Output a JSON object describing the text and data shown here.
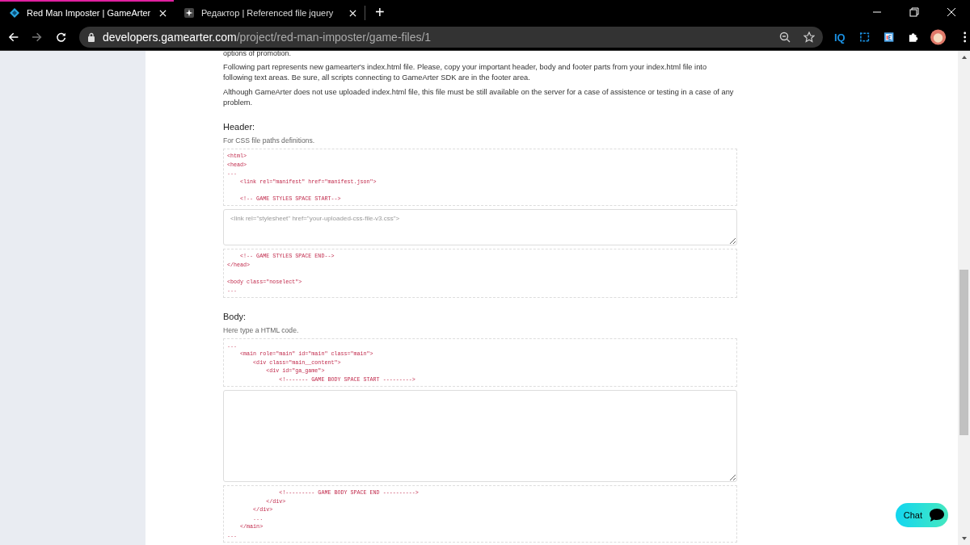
{
  "browser": {
    "tabs": [
      {
        "title": "Red Man Imposter | GameArter",
        "selected": true
      },
      {
        "title": "Редактор | Referenced file jquery",
        "selected": false
      }
    ],
    "new_tab": "+",
    "address": {
      "domain": "developers.gamearter.com",
      "path": "/project/red-man-imposter/game-files/1"
    },
    "extension_label": "IQ"
  },
  "page": {
    "cut_line": "options of promotion.",
    "paragraphs": [
      "Following part represents new gamearter's index.html file. Please, copy your important header, body and footer parts from your index.html file into following text areas. Be sure, all scripts connecting to GameArter SDK are in the footer area.",
      "Although GameArter does not use uploaded index.html file, this file must be still available on the server for a case of assistence or testing in a case of any problem."
    ],
    "sections": [
      {
        "heading": "Header:",
        "hint": "For CSS file paths definitions.",
        "blocks": [
          {
            "kind": "code",
            "groups": [
              [
                "<html>",
                "<head>",
                "...",
                "    <link rel=\"manifest\" href=\"manifest.json\">"
              ],
              [
                "    <!-- GAME STYLES SPACE START-->"
              ]
            ]
          },
          {
            "kind": "textarea",
            "placeholder": "<link rel=\"stylesheet\" href=\"your-uploaded-css-file-v3.css\">"
          },
          {
            "kind": "code",
            "groups": [
              [
                "    <!-- GAME STYLES SPACE END-->",
                "</head>"
              ],
              [
                "<body class=\"noselect\">",
                "..."
              ]
            ]
          }
        ]
      },
      {
        "heading": "Body:",
        "hint": "Here type a HTML code.",
        "blocks": [
          {
            "kind": "code",
            "groups": [
              [
                "...",
                "    <main role=\"main\" id=\"main\" class=\"main\">",
                "        <div class=\"main__content\">",
                "            <div id=\"ga_game\">",
                "                <!------- GAME BODY SPACE START --------->"
              ]
            ]
          },
          {
            "kind": "textarea_tall"
          },
          {
            "kind": "code",
            "groups": [
              [
                "                <!--------- GAME BODY SPACE END ---------->",
                "            </div>",
                "        </div>",
                "        ...",
                "    </main>",
                "..."
              ]
            ]
          }
        ]
      }
    ]
  },
  "chat": {
    "label": "Chat"
  }
}
